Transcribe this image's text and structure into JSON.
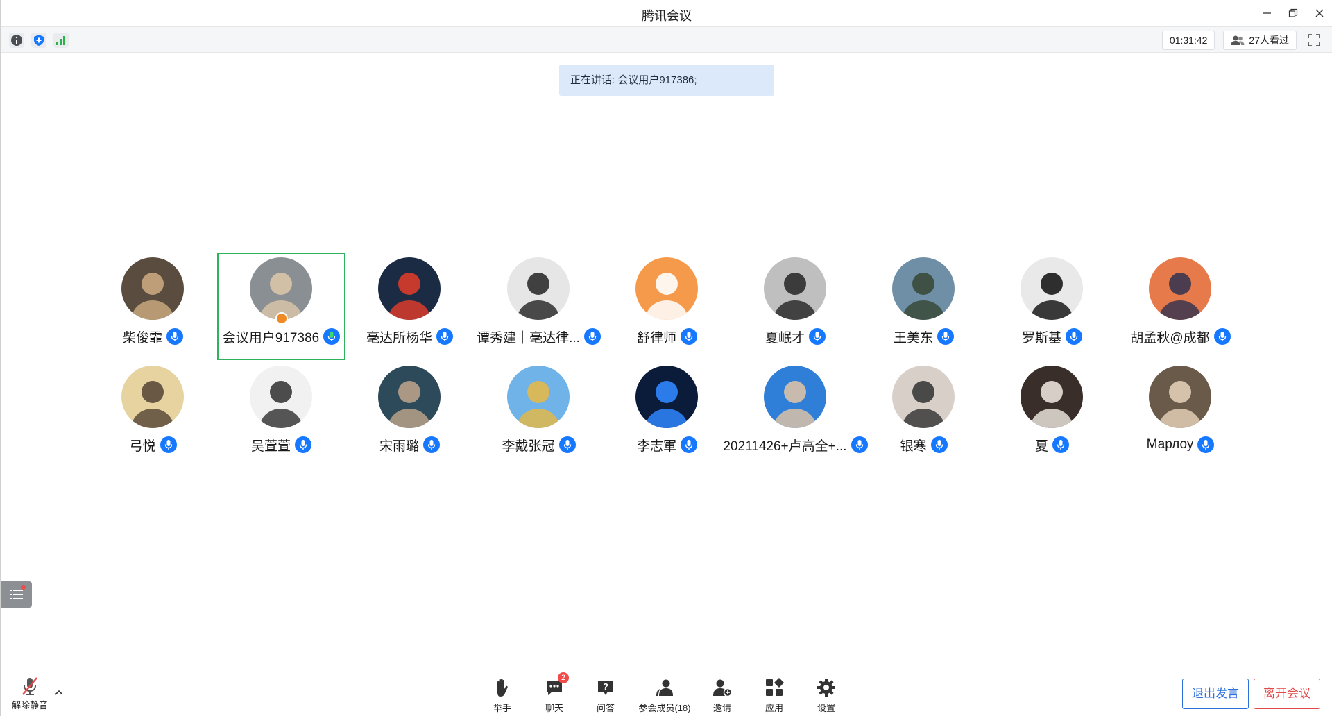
{
  "window": {
    "title": "腾讯会议"
  },
  "status": {
    "timer": "01:31:42",
    "viewers": "27人看过"
  },
  "speaking": {
    "text": "正在讲话: 会议用户917386;"
  },
  "participants": [
    {
      "name": "柴俊霏",
      "avatar": "teddy-bear-avatar",
      "colors": [
        "#5a4c3f",
        "#c8a77e"
      ]
    },
    {
      "name": "会议用户917386",
      "avatar": "woman-portrait-avatar",
      "colors": [
        "#8a8f93",
        "#d8c4a8"
      ],
      "active": true,
      "host": true
    },
    {
      "name": "毫达所杨华",
      "avatar": "rose-flag-avatar",
      "colors": [
        "#1b2b44",
        "#d93b2b"
      ]
    },
    {
      "name": "谭秀建｜毫达律...",
      "avatar": "man-suit-avatar",
      "colors": [
        "#e6e6e6",
        "#2d2d2d"
      ]
    },
    {
      "name": "舒律师",
      "avatar": "cartoon-dog-avatar",
      "colors": [
        "#f59a4a",
        "#ffffff"
      ]
    },
    {
      "name": "夏岷才",
      "avatar": "man-suit-avatar",
      "colors": [
        "#bfbfbf",
        "#2c2c2c"
      ]
    },
    {
      "name": "王美东",
      "avatar": "sea-cliff-avatar",
      "colors": [
        "#6f8fa6",
        "#3a4a3a"
      ]
    },
    {
      "name": "罗斯基",
      "avatar": "bw-portrait-avatar",
      "colors": [
        "#e9e9e9",
        "#1a1a1a"
      ]
    },
    {
      "name": "胡孟秋@成都",
      "avatar": "sunset-sky-avatar",
      "colors": [
        "#e77a4a",
        "#3a3550"
      ]
    },
    {
      "name": "弓悦",
      "avatar": "anime-pilot-avatar",
      "colors": [
        "#e7d3a0",
        "#5a4a3a"
      ]
    },
    {
      "name": "吴萱萱",
      "avatar": "anime-girl-avatar",
      "colors": [
        "#f1f1f1",
        "#3a3a3a"
      ]
    },
    {
      "name": "宋雨璐",
      "avatar": "woman-portrait-avatar",
      "colors": [
        "#2d4a5a",
        "#b8a088"
      ]
    },
    {
      "name": "李戴张冠",
      "avatar": "wheat-field-avatar",
      "colors": [
        "#6fb3e8",
        "#e2b84a"
      ]
    },
    {
      "name": "李志軍",
      "avatar": "neon-lion-avatar",
      "colors": [
        "#0b1b3a",
        "#2f86ff"
      ]
    },
    {
      "name": "20211426+卢高全+...",
      "avatar": "man-portrait-avatar",
      "colors": [
        "#2f7fd8",
        "#d9c2a8"
      ]
    },
    {
      "name": "银寒",
      "avatar": "man-glasses-avatar",
      "colors": [
        "#d8d0c8",
        "#3a3a3a"
      ]
    },
    {
      "name": "夏",
      "avatar": "cat-avatar",
      "colors": [
        "#3a2e2a",
        "#e8e0d8"
      ]
    },
    {
      "name": "Марлоу",
      "avatar": "child-smiling-avatar",
      "colors": [
        "#6a5a4a",
        "#e2cdb5"
      ]
    }
  ],
  "toolbar": {
    "unmute_label": "解除静音",
    "raise_hand_label": "举手",
    "chat_label": "聊天",
    "chat_badge": "2",
    "qa_label": "问答",
    "members_label": "参会成员(18)",
    "invite_label": "邀请",
    "apps_label": "应用",
    "settings_label": "设置",
    "exit_speaking_label": "退出发言",
    "leave_meeting_label": "离开会议"
  },
  "colors": {
    "accent": "#1677ff",
    "active_border": "#2fb25b",
    "leave": "#e24a4a",
    "exit_speak": "#2a6fdb"
  }
}
